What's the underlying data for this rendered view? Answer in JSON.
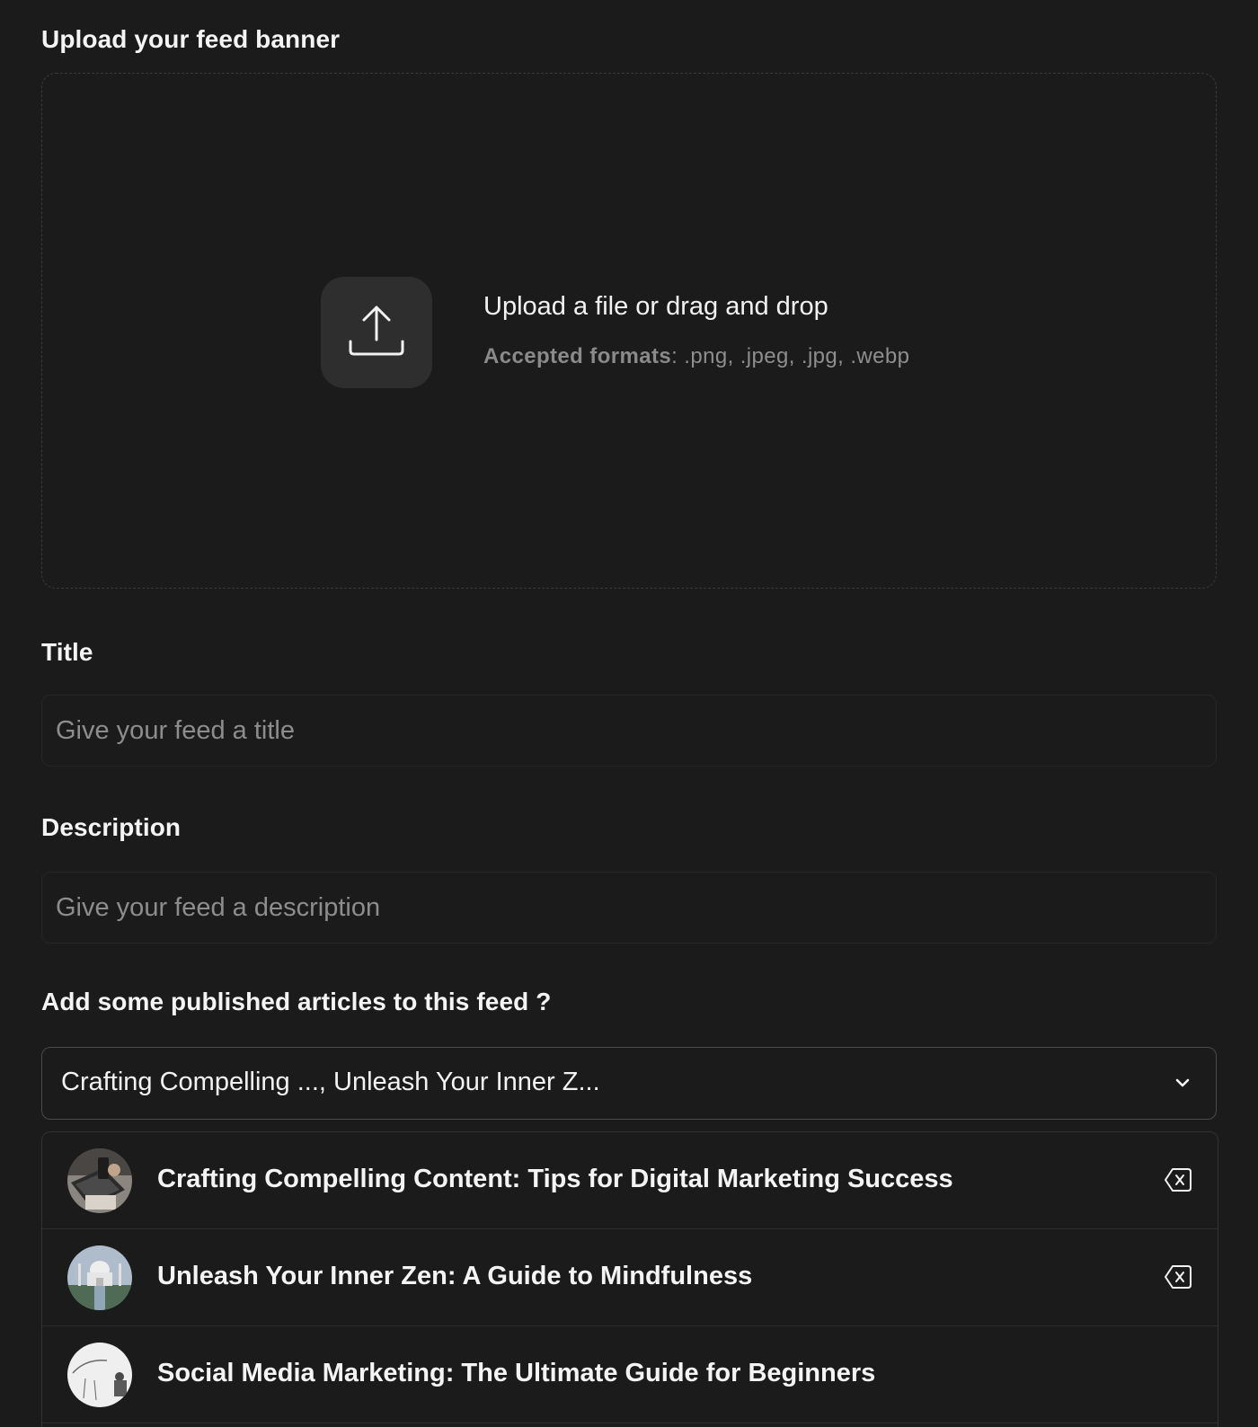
{
  "banner": {
    "label": "Upload your feed banner",
    "upload_title": "Upload a file or drag and drop",
    "formats_key": "Accepted formats",
    "formats_value": ": .png, .jpeg, .jpg, .webp",
    "icon": "upload-icon"
  },
  "title_field": {
    "label": "Title",
    "placeholder": "Give your feed a title",
    "value": ""
  },
  "description_field": {
    "label": "Description",
    "placeholder": "Give your feed a description",
    "value": ""
  },
  "articles": {
    "label": "Add some published articles to this feed ?",
    "selected_summary": "Crafting Compelling ..., Unleash Your Inner Z...",
    "dropdown_icon": "chevron-down-icon",
    "options": [
      {
        "title": "Crafting Compelling Content: Tips for Digital Marketing Success",
        "selected": true,
        "thumbnail": "laptop-phone-photo"
      },
      {
        "title": "Unleash Your Inner Zen: A Guide to Mindfulness",
        "selected": true,
        "thumbnail": "taj-mahal-photo"
      },
      {
        "title": "Social Media Marketing: The Ultimate Guide for Beginners",
        "selected": false,
        "thumbnail": "audience-sketch-photo"
      }
    ]
  },
  "colors": {
    "background": "#1b1b1b",
    "icon_box": "#2e2e2e",
    "text_primary": "#f2f2f2",
    "text_muted": "#8d8d8d",
    "border": "#4a4a4a"
  }
}
